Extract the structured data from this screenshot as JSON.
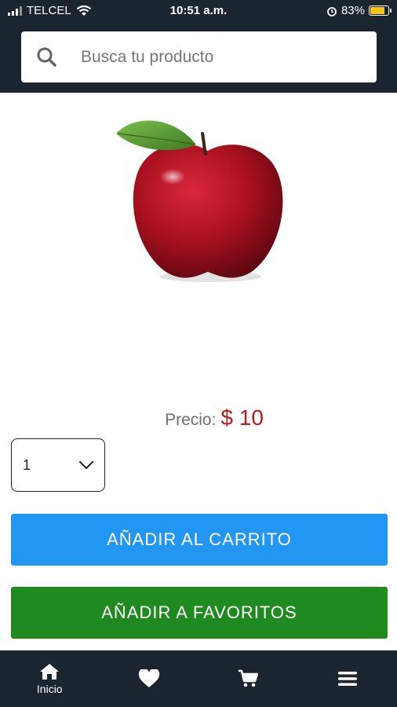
{
  "status_bar": {
    "carrier": "TELCEL",
    "time": "10:51 a.m.",
    "battery": "83%",
    "battery_level": 0.83
  },
  "search": {
    "placeholder": "Busca tu producto"
  },
  "product": {
    "image": "red-apple",
    "price_label": "Precio:",
    "price_value": "$ 10"
  },
  "quantity": {
    "selected": "1"
  },
  "buttons": {
    "add_to_cart": "AÑADIR AL CARRITO",
    "add_to_favorites": "AÑADIR A FAVORITOS"
  },
  "bottom_nav": {
    "home_label": "Inicio",
    "icons": [
      "home-icon",
      "heart-icon",
      "cart-icon",
      "menu-icon"
    ]
  },
  "colors": {
    "bar_background": "#1b2530",
    "cart_button": "#2196f3",
    "favorites_button": "#1f8a1f",
    "price": "#b71c1c"
  }
}
